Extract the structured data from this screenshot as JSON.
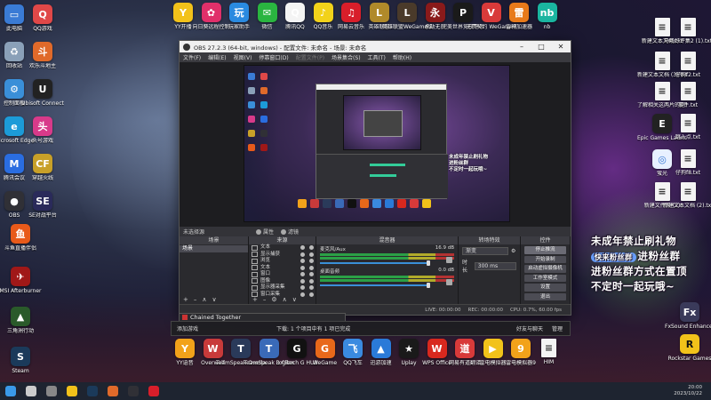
{
  "desktop_left_icons": [
    {
      "label": "此电脑",
      "icon": "computer-icon",
      "color": "#3a7bd5",
      "glyph": "▭"
    },
    {
      "label": "QQ游戏",
      "icon": "qq-game-icon",
      "color": "#e04848",
      "glyph": "Q"
    },
    {
      "label": "回收站",
      "icon": "recycle-bin-icon",
      "color": "#8aa0b8",
      "glyph": "♻"
    },
    {
      "label": "欢乐斗地主",
      "icon": "landlord-game-icon",
      "color": "#e06a2a",
      "glyph": "斗"
    },
    {
      "label": "控制面板",
      "icon": "control-panel-icon",
      "color": "#3a8fd8",
      "glyph": "⚙"
    },
    {
      "label": "Ubisoft Connect",
      "icon": "ubisoft-icon",
      "color": "#222222",
      "glyph": "U"
    },
    {
      "label": "Microsoft Edge",
      "icon": "edge-icon",
      "color": "#1c9bd8",
      "glyph": "e"
    },
    {
      "label": "头号游戏",
      "icon": "toutiao-game-icon",
      "color": "#d83a8a",
      "glyph": "头"
    },
    {
      "label": "腾讯会议",
      "icon": "tencent-meeting-icon",
      "color": "#2a6de0",
      "glyph": "M"
    },
    {
      "label": "穿越火线",
      "icon": "crossfire-icon",
      "color": "#c8a028",
      "glyph": "CF"
    },
    {
      "label": "OBS",
      "icon": "obs-icon",
      "color": "#303036",
      "glyph": "●"
    },
    {
      "label": "SE对战平台",
      "icon": "se-platform-icon",
      "color": "#2a2a5a",
      "glyph": "SE"
    },
    {
      "label": "斗鱼直播伴侣",
      "icon": "douyu-icon",
      "color": "#e85a1a",
      "glyph": "鱼"
    },
    {
      "label": "MSI Afterburner",
      "icon": "msi-afterburner-icon",
      "color": "#a01818",
      "glyph": "✈"
    },
    {
      "label": "三角洲行动",
      "icon": "delta-force-icon",
      "color": "#2a5a2a",
      "glyph": "▲"
    },
    {
      "label": "Steam",
      "icon": "steam-icon",
      "color": "#1b3a5a",
      "glyph": "S"
    }
  ],
  "desktop_top_icons": [
    {
      "label": "YY开播",
      "icon": "yy-live-icon",
      "color": "#f2c21a",
      "glyph": "Y"
    },
    {
      "label": "向日葵远程控制",
      "icon": "sunflower-icon",
      "color": "#e0306a",
      "glyph": "✿"
    },
    {
      "label": "玩家助手",
      "icon": "player-assistant-icon",
      "color": "#2a8ae0",
      "glyph": "玩"
    },
    {
      "label": "微信",
      "icon": "wechat-icon",
      "color": "#2ab540",
      "glyph": "✉"
    },
    {
      "label": "腾讯QQ",
      "icon": "qq-icon",
      "color": "#f4f4f4",
      "glyph": "Q"
    },
    {
      "label": "QQ音乐",
      "icon": "qq-music-icon",
      "color": "#f2d21a",
      "glyph": "♪"
    },
    {
      "label": "网易云音乐",
      "icon": "netease-music-icon",
      "color": "#d81e2a",
      "glyph": "♫"
    },
    {
      "label": "英雄联盟",
      "icon": "lol-icon",
      "color": "#b08a2a",
      "glyph": "L"
    },
    {
      "label": "英雄联盟WeGame版",
      "icon": "lol-wegame-icon",
      "color": "#4a3a2a",
      "glyph": "L"
    },
    {
      "label": "永劫无间",
      "icon": "naraka-icon",
      "color": "#8a1a1a",
      "glyph": "永"
    },
    {
      "label": "完美世界竞技平台",
      "icon": "perfect-world-icon",
      "color": "#1a1a1a",
      "glyph": "P"
    },
    {
      "label": "无畏契约 WeGame版",
      "icon": "valorant-icon",
      "color": "#d83a3a",
      "glyph": "V"
    },
    {
      "label": "雷神加速器",
      "icon": "leishen-icon",
      "color": "#e87a1a",
      "glyph": "雷"
    },
    {
      "label": "nb",
      "icon": "nb-icon",
      "color": "#1ab5a0",
      "glyph": "nb"
    }
  ],
  "desktop_right_icons": [
    {
      "label": "新建文本文档.txt",
      "icon": "text-file-icon"
    },
    {
      "label": "马场好评集2 (1).txt",
      "icon": "text-file-icon"
    },
    {
      "label": "新建文本文档 (3).txt",
      "icon": "text-file-icon"
    },
    {
      "label": "仔狗f2.txt",
      "icon": "text-file-icon"
    },
    {
      "label": "了解相关这两片的信息",
      "icon": "info-file-icon"
    },
    {
      "label": "事件.txt",
      "icon": "text-file-icon"
    },
    {
      "label": "Epic Games Launcher",
      "icon": "epic-games-icon"
    },
    {
      "label": "跳入点.txt",
      "icon": "text-file-icon"
    },
    {
      "label": "萤光",
      "icon": "firefly-icon"
    },
    {
      "label": "仔狗f8.txt",
      "icon": "text-file-icon"
    },
    {
      "label": "新建文件夹 (2)",
      "icon": "text-file-icon"
    },
    {
      "label": "新建文本文档 (2).txt",
      "icon": "text-file-icon"
    },
    {
      "label": "FxSound Enhancer",
      "icon": "fxsound-icon"
    },
    {
      "label": "Rockstar Games",
      "icon": "rockstar-icon"
    }
  ],
  "desktop_bottom_icons": [
    {
      "label": "YY语音",
      "icon": "yy-voice-icon",
      "color": "#f2a21a",
      "glyph": "Y"
    },
    {
      "label": "Overwolf",
      "icon": "overwolf-icon",
      "color": "#c83a3a",
      "glyph": "W"
    },
    {
      "label": "TeamSpeak Overlay",
      "icon": "teamspeak-overlay-icon",
      "color": "#2a3a5a",
      "glyph": "T"
    },
    {
      "label": "TeamSpeak 3 Client",
      "icon": "teamspeak-icon",
      "color": "#3a6ab8",
      "glyph": "T"
    },
    {
      "label": "Logitech G HUB",
      "icon": "logitech-icon",
      "color": "#111111",
      "glyph": "G"
    },
    {
      "label": "WeGame",
      "icon": "wegame-icon",
      "color": "#e8681a",
      "glyph": "G"
    },
    {
      "label": "QQ飞车",
      "icon": "qq-speed-icon",
      "color": "#3a8ae0",
      "glyph": "飞"
    },
    {
      "label": "迅游加速",
      "icon": "xunyou-icon",
      "color": "#2a7ad8",
      "glyph": "▲"
    },
    {
      "label": "Uplay",
      "icon": "uplay-icon",
      "color": "#1a1a1a",
      "glyph": "★"
    },
    {
      "label": "WPS Office",
      "icon": "wps-icon",
      "color": "#d8281e",
      "glyph": "W"
    },
    {
      "label": "网易有道翻译",
      "icon": "youdao-icon",
      "color": "#d83a3a",
      "glyph": "道"
    },
    {
      "label": "雷电模拟器",
      "icon": "ldplayer-icon",
      "color": "#f2c21a",
      "glyph": "▶"
    },
    {
      "label": "雷电模拟器9",
      "icon": "ldplayer9-icon",
      "color": "#f2a21a",
      "glyph": "9"
    },
    {
      "label": "HIM",
      "icon": "file-icon",
      "color": "#f4f4f4",
      "glyph": ""
    }
  ],
  "obs": {
    "title": "OBS 27.2.3 (64-bit, windows) - 配置文件: 未命名 - 场景: 未命名",
    "menu": [
      "文件(F)",
      "编辑(E)",
      "视图(V)",
      "停靠窗口(D)",
      "配置文件(P)",
      "场景集合(S)",
      "工具(T)",
      "帮助(H)"
    ],
    "menu_disabled": [
      false,
      false,
      false,
      false,
      true,
      false,
      false,
      false
    ],
    "scene_label": "未选择源",
    "scene_buttons": [
      "属性",
      "滤镜"
    ],
    "docks": {
      "scenes": {
        "title": "场景",
        "items": [
          "场景"
        ]
      },
      "sources": {
        "title": "来源",
        "items": [
          "文本",
          "显示捕获",
          "浏览",
          "文本",
          "窗口",
          "图像",
          "显示器采集",
          "窗口采集"
        ]
      },
      "mixer": {
        "title": "混音器",
        "channels": [
          {
            "name": "麦克风/Aux",
            "level": "16.9 dB"
          },
          {
            "name": "桌面音频",
            "level": "0.0 dB"
          }
        ]
      },
      "transitions": {
        "title": "转场特效",
        "type": "渐变",
        "duration_label": "时长",
        "duration": "300 ms"
      },
      "controls": {
        "title": "控件",
        "buttons": [
          "停止推流",
          "开始录制",
          "启动虚拟摄像机",
          "工作室模式",
          "设置",
          "退出"
        ]
      }
    },
    "status": [
      "LIVE: 00:00:00",
      "REC: 00:00:00",
      "CPU: 0.7%, 60.00 fps"
    ]
  },
  "chained_window": {
    "title": "Chained Together"
  },
  "desk_dock": {
    "left": "添加游戏",
    "middle": "下载: 1 个项目中有 1 项已完成",
    "right_items": [
      "好友与聊天",
      "管理"
    ]
  },
  "promo": {
    "line1": "未成年禁止刷礼物",
    "badge": "快来粉丝群",
    "line2_rest": "进粉丝群",
    "line3": "进粉丝群方式在置顶",
    "line4": "不定时一起玩哦~"
  },
  "taskbar": {
    "items": [
      "windows-start-icon",
      "search-icon",
      "task-view-icon",
      "file-explorer-icon",
      "steam-icon",
      "game-icon",
      "obs-icon",
      "netease-music-icon"
    ],
    "time": "20:00",
    "date": "2023/10/22"
  }
}
